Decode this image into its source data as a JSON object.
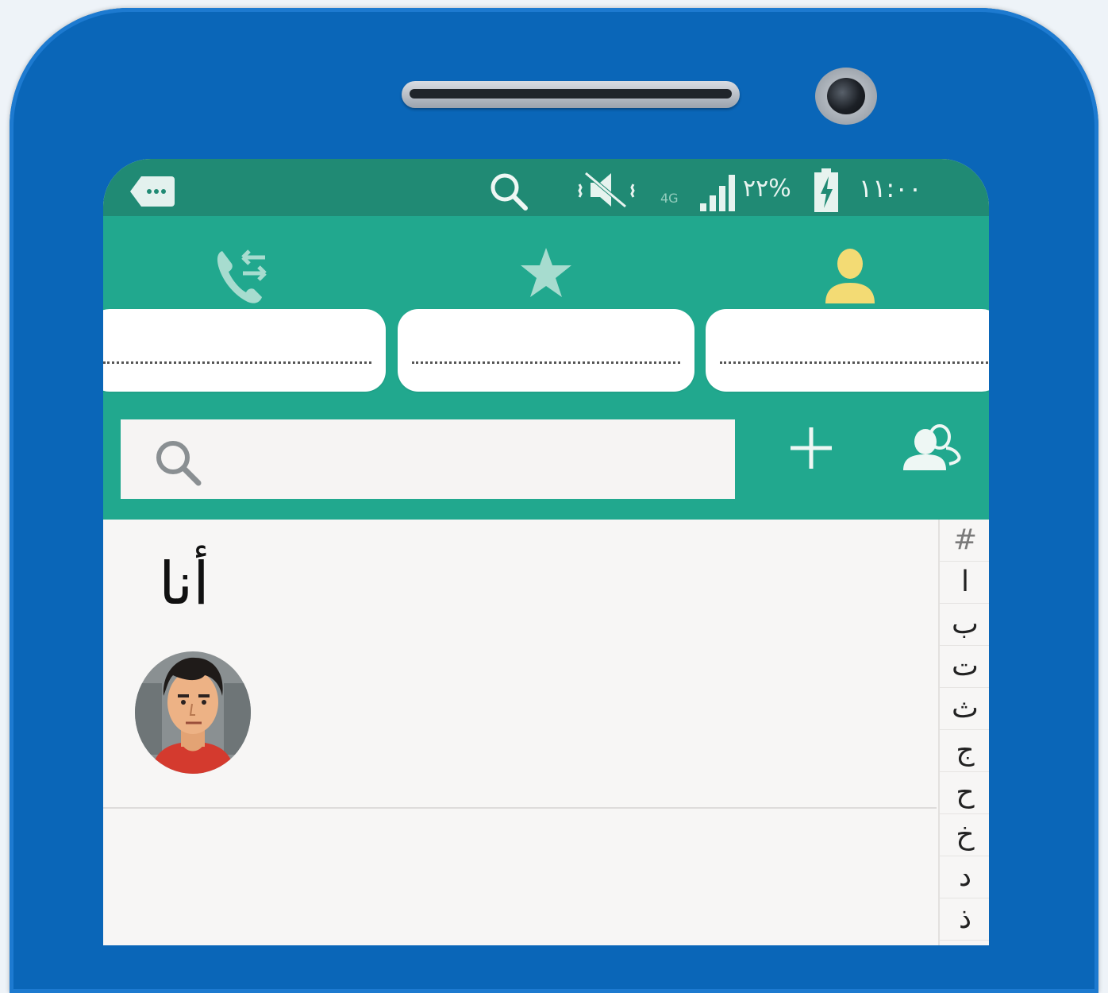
{
  "status_bar": {
    "network": "4G",
    "battery_percent": "٢٢%",
    "time": "١١:٠٠"
  },
  "tabs": [
    {
      "icon": "call-log-icon",
      "label": ""
    },
    {
      "icon": "star-icon",
      "label": ""
    },
    {
      "icon": "contact-person-icon",
      "label": ""
    }
  ],
  "search": {
    "placeholder": ""
  },
  "actions": {
    "add_icon": "plus-icon",
    "groups_icon": "groups-icon"
  },
  "contacts": {
    "me_label": "أنا"
  },
  "index_letters": [
    "#",
    "ا",
    "ب",
    "ت",
    "ث",
    "ج",
    "ح",
    "خ",
    "د",
    "ذ"
  ],
  "colors": {
    "phone_body": "#0a66b8",
    "status_bar": "#208a74",
    "header": "#21a88e",
    "active_tab_icon": "#f3db74",
    "inactive_tab_icon": "#a7dccf"
  }
}
